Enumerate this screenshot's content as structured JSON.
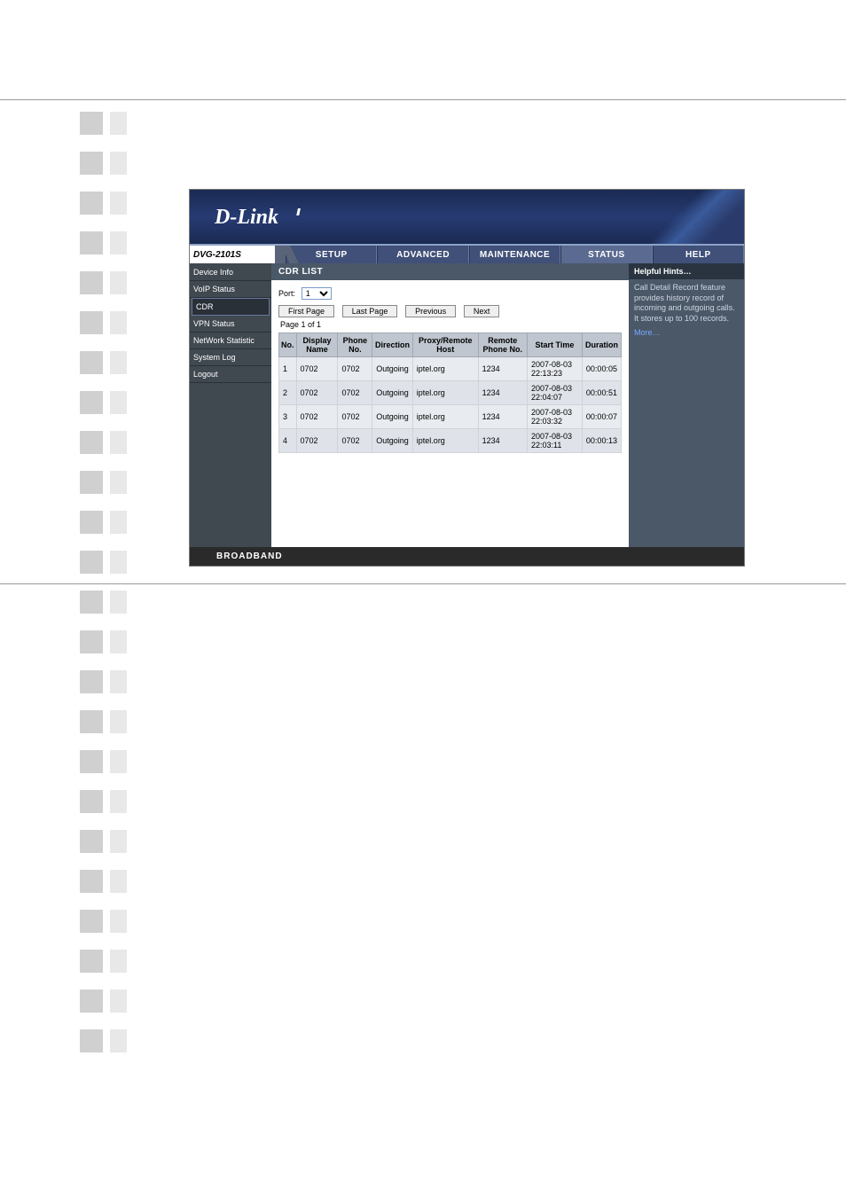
{
  "doc": {
    "brand": "D-Link",
    "model": "DVG-2101S",
    "footer": "BROADBAND"
  },
  "nav": {
    "items": [
      "SETUP",
      "ADVANCED",
      "MAINTENANCE",
      "STATUS",
      "HELP"
    ],
    "selected": 3
  },
  "sidebar": {
    "items": [
      "Device Info",
      "VoIP Status",
      "CDR",
      "VPN Status",
      "NetWork Statistic",
      "System Log",
      "Logout"
    ],
    "selected": 2
  },
  "panel": {
    "title": "CDR LIST",
    "port_label": "Port:",
    "port_value": "1",
    "buttons": {
      "first": "First Page",
      "last": "Last Page",
      "prev": "Previous",
      "next": "Next"
    },
    "page_info": "Page 1 of 1",
    "columns": [
      "No.",
      "Display Name",
      "Phone No.",
      "Direction",
      "Proxy/Remote Host",
      "Remote Phone No.",
      "Start Time",
      "Duration"
    ],
    "rows": [
      {
        "no": "1",
        "name": "0702",
        "phone": "0702",
        "dir": "Outgoing",
        "host": "iptel.org",
        "remote": "1234",
        "start": "2007-08-03 22:13:23",
        "dur": "00:00:05"
      },
      {
        "no": "2",
        "name": "0702",
        "phone": "0702",
        "dir": "Outgoing",
        "host": "iptel.org",
        "remote": "1234",
        "start": "2007-08-03 22:04:07",
        "dur": "00:00:51"
      },
      {
        "no": "3",
        "name": "0702",
        "phone": "0702",
        "dir": "Outgoing",
        "host": "iptel.org",
        "remote": "1234",
        "start": "2007-08-03 22:03:32",
        "dur": "00:00:07"
      },
      {
        "no": "4",
        "name": "0702",
        "phone": "0702",
        "dir": "Outgoing",
        "host": "iptel.org",
        "remote": "1234",
        "start": "2007-08-03 22:03:11",
        "dur": "00:00:13"
      }
    ]
  },
  "help": {
    "header": "Helpful Hints…",
    "body": "Call Detail Record feature provides history record of incoming and outgoing calls. It stores up to 100 records.",
    "more": "More…"
  }
}
